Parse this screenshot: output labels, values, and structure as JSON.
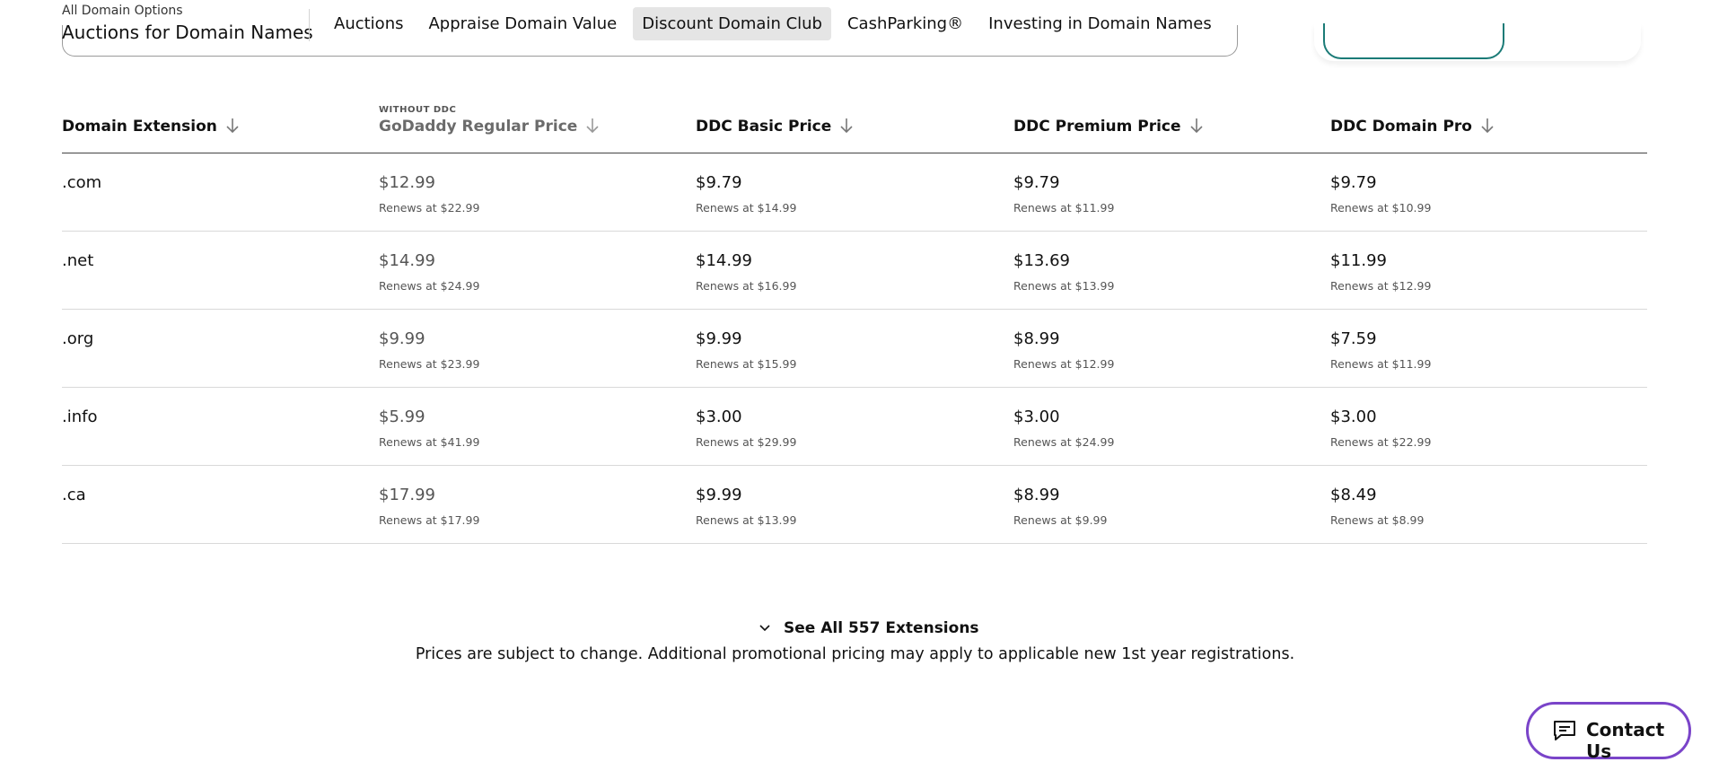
{
  "header": {
    "breadcrumb_small": "All Domain Options",
    "title": "Auctions for Domain Names",
    "nav": [
      {
        "label": "Auctions",
        "active": false
      },
      {
        "label": "Appraise Domain Value",
        "active": false
      },
      {
        "label": "Discount Domain Club",
        "active": true
      },
      {
        "label": "CashParking®",
        "active": false
      },
      {
        "label": "Investing in Domain Names",
        "active": false
      }
    ]
  },
  "table": {
    "headers": {
      "ext": "Domain Extension",
      "regular_over": "WITHOUT DDC",
      "regular": "GoDaddy Regular Price",
      "basic": "DDC Basic Price",
      "premium": "DDC Premium Price",
      "pro": "DDC Domain Pro"
    },
    "rows": [
      {
        "ext": ".com",
        "regular": {
          "price": "$12.99",
          "renew": "Renews at $22.99"
        },
        "basic": {
          "price": "$9.79",
          "renew": "Renews at $14.99"
        },
        "premium": {
          "price": "$9.79",
          "renew": "Renews at $11.99"
        },
        "pro": {
          "price": "$9.79",
          "renew": "Renews at $10.99"
        }
      },
      {
        "ext": ".net",
        "regular": {
          "price": "$14.99",
          "renew": "Renews at $24.99"
        },
        "basic": {
          "price": "$14.99",
          "renew": "Renews at $16.99"
        },
        "premium": {
          "price": "$13.69",
          "renew": "Renews at $13.99"
        },
        "pro": {
          "price": "$11.99",
          "renew": "Renews at $12.99"
        }
      },
      {
        "ext": ".org",
        "regular": {
          "price": "$9.99",
          "renew": "Renews at $23.99"
        },
        "basic": {
          "price": "$9.99",
          "renew": "Renews at $15.99"
        },
        "premium": {
          "price": "$8.99",
          "renew": "Renews at $12.99"
        },
        "pro": {
          "price": "$7.59",
          "renew": "Renews at $11.99"
        }
      },
      {
        "ext": ".info",
        "regular": {
          "price": "$5.99",
          "renew": "Renews at $41.99"
        },
        "basic": {
          "price": "$3.00",
          "renew": "Renews at $29.99"
        },
        "premium": {
          "price": "$3.00",
          "renew": "Renews at $24.99"
        },
        "pro": {
          "price": "$3.00",
          "renew": "Renews at $22.99"
        }
      },
      {
        "ext": ".ca",
        "regular": {
          "price": "$17.99",
          "renew": "Renews at $17.99"
        },
        "basic": {
          "price": "$9.99",
          "renew": "Renews at $13.99"
        },
        "premium": {
          "price": "$8.99",
          "renew": "Renews at $9.99"
        },
        "pro": {
          "price": "$8.49",
          "renew": "Renews at $8.99"
        }
      }
    ]
  },
  "footer": {
    "see_all": "See All 557 Extensions",
    "disclaimer": "Prices are subject to change. Additional promotional pricing may apply to applicable new 1st year registrations.",
    "contact": "Contact Us"
  },
  "colors": {
    "contact_border": "#7a44c9",
    "pill_border": "#1b7b77",
    "active_nav_bg": "#e5e5e5"
  }
}
